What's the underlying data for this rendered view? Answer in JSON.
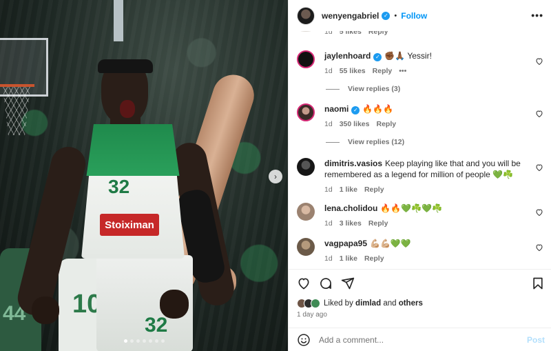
{
  "post": {
    "username": "wenyengabriel",
    "follow_label": "Follow",
    "separator": "•",
    "jersey_number": "32",
    "sponsor_text": "Stoiximan",
    "background_numbers": [
      "44",
      "10"
    ],
    "carousel": {
      "dot_count": 7,
      "active_index": 0
    }
  },
  "colors": {
    "accent": "#0095f6",
    "verified": "#1c9bf0",
    "meta_text": "#737373",
    "jersey_green": "#1f8a4c"
  },
  "comments": [
    {
      "username": "",
      "text": "",
      "time": "1d",
      "likes": "5 likes",
      "reply": "Reply"
    },
    {
      "username": "jaylenhoard",
      "verified": true,
      "text": "✊🏾🙏🏾 Yessir!",
      "time": "1d",
      "likes": "55 likes",
      "reply": "Reply",
      "more": "•••",
      "view_replies": "View replies (3)"
    },
    {
      "username": "naomi",
      "verified": true,
      "text": "🔥🔥🔥",
      "time": "1d",
      "likes": "350 likes",
      "reply": "Reply",
      "view_replies": "View replies (12)"
    },
    {
      "username": "dimitris.vasios",
      "text": "Keep playing like that and you will be remembered as a legend for million of people 💚☘️",
      "time": "1d",
      "likes": "1 like",
      "reply": "Reply"
    },
    {
      "username": "lena.cholidou",
      "text": "🔥🔥💚☘️💚☘️",
      "time": "1d",
      "likes": "3 likes",
      "reply": "Reply"
    },
    {
      "username": "vagpapa95",
      "text": "💪🏼💪🏼💚💚",
      "time": "1d",
      "likes": "1 like",
      "reply": "Reply"
    }
  ],
  "likes": {
    "prefix": "Liked by",
    "user": "dimlad",
    "joiner": "and",
    "others": "others"
  },
  "time_ago": "1 day ago",
  "add_comment": {
    "placeholder": "Add a comment...",
    "post_label": "Post"
  },
  "icons": [
    "heart-icon",
    "comment-icon",
    "share-icon",
    "bookmark-icon",
    "emoji-icon",
    "more-icon",
    "chevron-right-icon",
    "verified-icon"
  ]
}
